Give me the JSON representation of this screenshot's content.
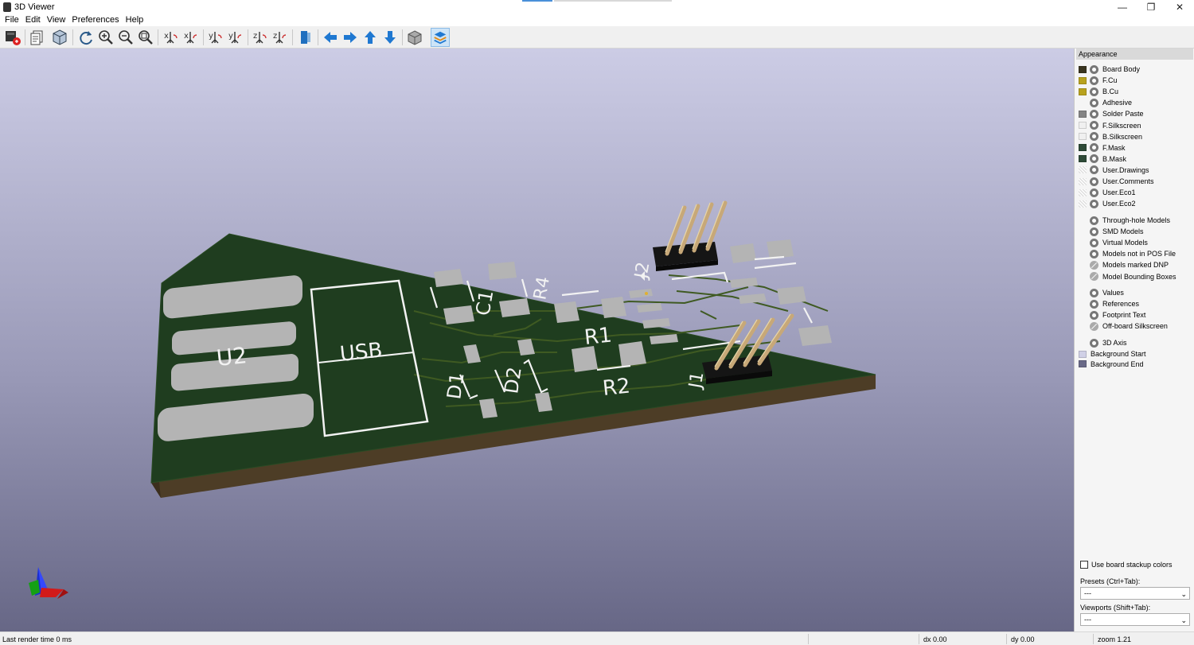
{
  "window": {
    "title": "3D Viewer"
  },
  "menu": [
    "File",
    "Edit",
    "View",
    "Preferences",
    "Help"
  ],
  "toolbar": {
    "icons": [
      "render-icon",
      "copy-image-icon",
      "board-3d-icon",
      "reload-icon",
      "zoom-in-icon",
      "zoom-out-icon",
      "zoom-fit-icon",
      "rotate-x-cw-icon",
      "rotate-x-ccw-icon",
      "rotate-y-cw-icon",
      "rotate-y-ccw-icon",
      "rotate-z-cw-icon",
      "rotate-z-ccw-icon",
      "flip-board-icon",
      "move-left-icon",
      "move-right-icon",
      "move-up-icon",
      "move-down-icon",
      "orthographic-icon",
      "layers-panel-icon"
    ],
    "active": "layers-panel-icon"
  },
  "board": {
    "silk_labels": [
      "U2",
      "USB",
      "C1",
      "R4",
      "R1",
      "R2",
      "D1",
      "D2",
      "J2",
      "J1"
    ],
    "colors": {
      "mask": "#1f3d1f",
      "copper": "#3f5a22",
      "pad": "#b4b4b4",
      "silk": "#f2f2f2",
      "edge": "#4d3d26",
      "pin": "#c7a878",
      "header": "#151515"
    }
  },
  "appearance": {
    "title": "Appearance",
    "layers": [
      {
        "name": "Board Body",
        "color": "#3a3520",
        "visible": true
      },
      {
        "name": "F.Cu",
        "color": "#b8a21e",
        "visible": true
      },
      {
        "name": "B.Cu",
        "color": "#b8a21e",
        "visible": true
      },
      {
        "name": "Adhesive",
        "color": "",
        "visible": true
      },
      {
        "name": "Solder Paste",
        "color": "#858585",
        "visible": true
      },
      {
        "name": "F.Silkscreen",
        "color": "#f0f0f0",
        "visible": true
      },
      {
        "name": "B.Silkscreen",
        "color": "#f0f0f0",
        "visible": true
      },
      {
        "name": "F.Mask",
        "color": "#2e4a37",
        "visible": true
      },
      {
        "name": "B.Mask",
        "color": "#2e4a37",
        "visible": true
      },
      {
        "name": "User.Drawings",
        "color": "check",
        "visible": true
      },
      {
        "name": "User.Comments",
        "color": "check",
        "visible": true
      },
      {
        "name": "User.Eco1",
        "color": "check",
        "visible": true
      },
      {
        "name": "User.Eco2",
        "color": "check",
        "visible": true
      }
    ],
    "models": [
      {
        "name": "Through-hole Models",
        "visible": true
      },
      {
        "name": "SMD Models",
        "visible": true
      },
      {
        "name": "Virtual Models",
        "visible": true
      },
      {
        "name": "Models not in POS File",
        "visible": true
      },
      {
        "name": "Models marked DNP",
        "visible": false
      },
      {
        "name": "Model Bounding Boxes",
        "visible": false
      }
    ],
    "texts": [
      {
        "name": "Values",
        "visible": true
      },
      {
        "name": "References",
        "visible": true
      },
      {
        "name": "Footprint Text",
        "visible": true
      },
      {
        "name": "Off-board Silkscreen",
        "visible": false
      }
    ],
    "axis": {
      "name": "3D Axis",
      "visible": true
    },
    "backgrounds": [
      {
        "name": "Background Start",
        "color": "#d0d0e6"
      },
      {
        "name": "Background End",
        "color": "#6a6a88"
      }
    ],
    "use_stackup": "Use board stackup colors",
    "presets_label": "Presets (Ctrl+Tab):",
    "presets_value": "---",
    "viewports_label": "Viewports (Shift+Tab):",
    "viewports_value": "---"
  },
  "status": {
    "render": "Last render time 0 ms",
    "dx": "dx 0.00",
    "dy": "dy 0.00",
    "zoom": "zoom 1.21"
  }
}
